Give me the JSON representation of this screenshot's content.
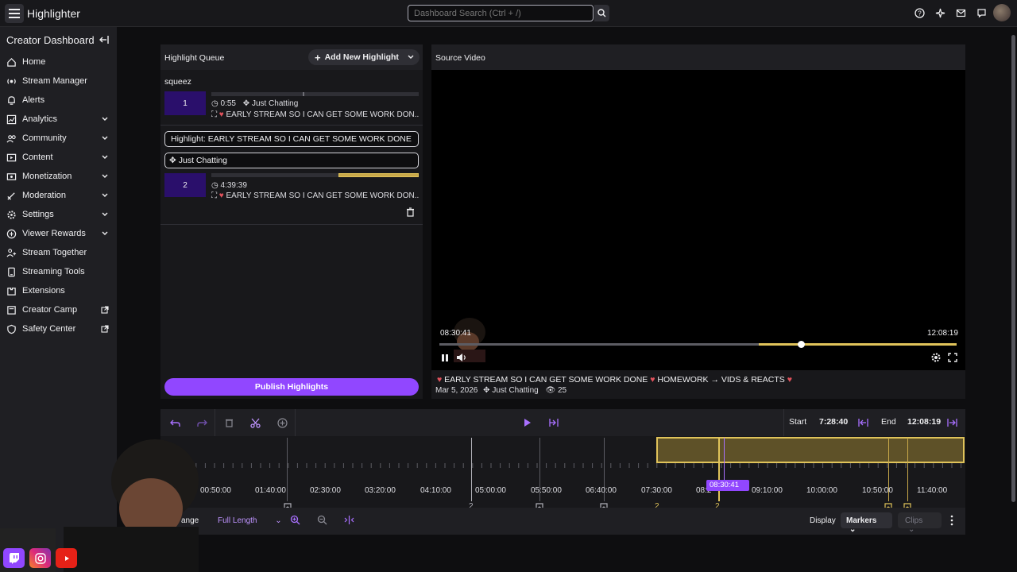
{
  "app": {
    "title": "Highlighter"
  },
  "search": {
    "placeholder": "Dashboard Search (Ctrl + /)"
  },
  "sidebar": {
    "title": "Creator Dashboard",
    "items": [
      {
        "label": "Home",
        "icon": "home-icon",
        "expandable": false
      },
      {
        "label": "Stream Manager",
        "icon": "stream-manager-icon",
        "expandable": false
      },
      {
        "label": "Alerts",
        "icon": "bell-icon",
        "expandable": false
      },
      {
        "label": "Analytics",
        "icon": "analytics-icon",
        "expandable": true
      },
      {
        "label": "Community",
        "icon": "community-icon",
        "expandable": true
      },
      {
        "label": "Content",
        "icon": "content-icon",
        "expandable": true
      },
      {
        "label": "Monetization",
        "icon": "monetization-icon",
        "expandable": true
      },
      {
        "label": "Moderation",
        "icon": "sword-icon",
        "expandable": true
      },
      {
        "label": "Settings",
        "icon": "gear-icon",
        "expandable": true
      },
      {
        "label": "Viewer Rewards",
        "icon": "rewards-icon",
        "expandable": true
      },
      {
        "label": "Stream Together",
        "icon": "stream-together-icon",
        "expandable": false
      },
      {
        "label": "Streaming Tools",
        "icon": "streaming-tools-icon",
        "expandable": false
      },
      {
        "label": "Extensions",
        "icon": "extensions-icon",
        "expandable": false
      },
      {
        "label": "Creator Camp",
        "icon": "creator-camp-icon",
        "expandable": false,
        "external": true
      },
      {
        "label": "Safety Center",
        "icon": "shield-icon",
        "expandable": false,
        "external": true
      }
    ]
  },
  "queue": {
    "title": "Highlight Queue",
    "add_label": "Add New Highlight",
    "group_name": "squeez",
    "item1": {
      "number": "1",
      "duration": "0:55",
      "category": "Just Chatting",
      "title": "EARLY STREAM SO I CAN GET SOME WORK DON..."
    },
    "highlight_field": "Highlight: EARLY STREAM SO I CAN GET SOME WORK DONE",
    "category_field": "Just Chatting",
    "item2": {
      "number": "2",
      "duration": "4:39:39",
      "title": "EARLY STREAM SO I CAN GET SOME WORK DON..."
    },
    "publish_label": "Publish Highlights"
  },
  "source": {
    "title": "Source Video",
    "current_time": "08:30:41",
    "end_time": "12:08:19",
    "progress": 0.7,
    "selection_start_fraction": 0.617,
    "video_title": "EARLY STREAM SO I CAN GET SOME WORK DONE",
    "video_title_rest": "HOMEWORK → VIDS & REACTS",
    "date": "Mar 5, 2026",
    "category": "Just Chatting",
    "views": "25"
  },
  "timeline": {
    "start_label": "Start",
    "start_value": "7:28:40",
    "end_label": "End",
    "end_value": "12:08:19",
    "ticks": [
      "00:50:00",
      "01:40:00",
      "02:30:00",
      "03:20:00",
      "04:10:00",
      "05:00:00",
      "05:50:00",
      "06:40:00",
      "07:30:00",
      "08:2",
      "09:10:00",
      "10:00:00",
      "10:50:00",
      "11:40:00"
    ],
    "playhead": "08:30:41",
    "range_label": "ange",
    "range_value": "Full Length",
    "display_label": "Display",
    "markers_label": "Markers",
    "clips_label": "Clips",
    "marker_count_a": "2",
    "marker_count_b": "2",
    "marker_count_c": "2"
  },
  "colors": {
    "accent": "#9147ff",
    "selection": "#e0c35a",
    "background": "#0e0e10"
  }
}
